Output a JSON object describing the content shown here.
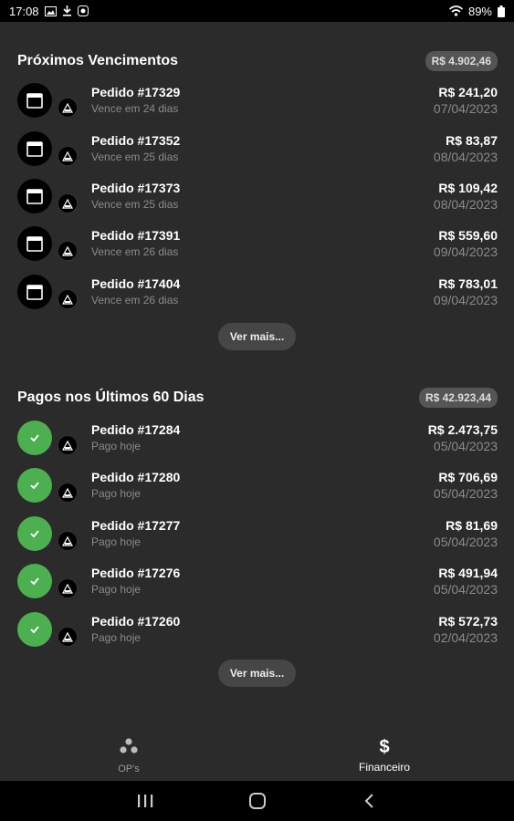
{
  "status_bar": {
    "time": "17:08",
    "battery": "89%"
  },
  "upcoming": {
    "title": "Próximos Vencimentos",
    "total": "R$ 4.902,46",
    "items": [
      {
        "title": "Pedido #17329",
        "subtitle": "Vence em 24 dias",
        "amount": "R$ 241,20",
        "date": "07/04/2023"
      },
      {
        "title": "Pedido #17352",
        "subtitle": "Vence em 25 dias",
        "amount": "R$ 83,87",
        "date": "08/04/2023"
      },
      {
        "title": "Pedido #17373",
        "subtitle": "Vence em 25 dias",
        "amount": "R$ 109,42",
        "date": "08/04/2023"
      },
      {
        "title": "Pedido #17391",
        "subtitle": "Vence em 26 dias",
        "amount": "R$ 559,60",
        "date": "09/04/2023"
      },
      {
        "title": "Pedido #17404",
        "subtitle": "Vence em 26 dias",
        "amount": "R$ 783,01",
        "date": "09/04/2023"
      }
    ],
    "more_label": "Ver mais..."
  },
  "paid": {
    "title": "Pagos nos Últimos 60 Dias",
    "total": "R$ 42.923,44",
    "items": [
      {
        "title": "Pedido #17284",
        "subtitle": "Pago hoje",
        "amount": "R$ 2.473,75",
        "date": "05/04/2023"
      },
      {
        "title": "Pedido #17280",
        "subtitle": "Pago hoje",
        "amount": "R$ 706,69",
        "date": "05/04/2023"
      },
      {
        "title": "Pedido #17277",
        "subtitle": "Pago hoje",
        "amount": "R$ 81,69",
        "date": "05/04/2023"
      },
      {
        "title": "Pedido #17276",
        "subtitle": "Pago hoje",
        "amount": "R$ 491,94",
        "date": "05/04/2023"
      },
      {
        "title": "Pedido #17260",
        "subtitle": "Pago hoje",
        "amount": "R$ 572,73",
        "date": "02/04/2023"
      }
    ],
    "more_label": "Ver mais..."
  },
  "bottom_nav": {
    "items": [
      {
        "label": "OP's",
        "icon": "three-dots-icon",
        "active": false
      },
      {
        "label": "Financeiro",
        "icon": "dollar-icon",
        "active": true
      }
    ]
  },
  "colors": {
    "background": "#2b2b2b",
    "paid_green": "#4caf50",
    "badge": "#555555"
  }
}
